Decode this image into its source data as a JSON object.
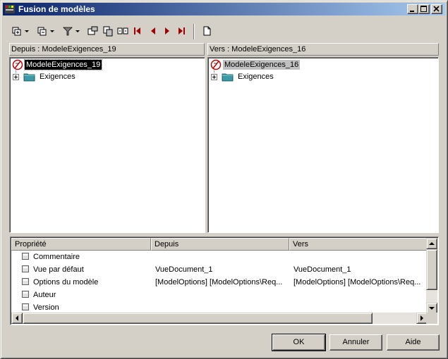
{
  "window": {
    "title": "Fusion de modèles",
    "title_bar_color": "#0a246a"
  },
  "toolbar": {
    "icons": [
      "expand-all-icon",
      "collapse-all-icon",
      "filter-icon",
      "select-icon",
      "copy-icon",
      "compare-icon",
      "first-difference-icon",
      "previous-difference-icon",
      "next-difference-icon",
      "last-difference-icon",
      "properties-icon"
    ],
    "nav_color": "#a00000"
  },
  "left_pane": {
    "header": "Depuis : ModeleExigences_19",
    "root": "ModeleExigences_19",
    "child": "Exigences"
  },
  "right_pane": {
    "header": "Vers : ModeleExigences_16",
    "root": "ModeleExigences_16",
    "child": "Exigences"
  },
  "properties": {
    "columns": [
      "Propriété",
      "Depuis",
      "Vers"
    ],
    "rows": [
      {
        "name": "Commentaire",
        "from": "",
        "to": ""
      },
      {
        "name": "Vue par défaut",
        "from": "VueDocument_1",
        "to": "VueDocument_1"
      },
      {
        "name": "Options du modèle",
        "from": "[ModelOptions]  [ModelOptions\\Req...",
        "to": "[ModelOptions]  [ModelOptions\\Req..."
      },
      {
        "name": "Auteur",
        "from": "",
        "to": ""
      },
      {
        "name": "Version",
        "from": "",
        "to": ""
      }
    ]
  },
  "buttons": {
    "ok": "OK",
    "cancel": "Annuler",
    "help": "Aide"
  }
}
